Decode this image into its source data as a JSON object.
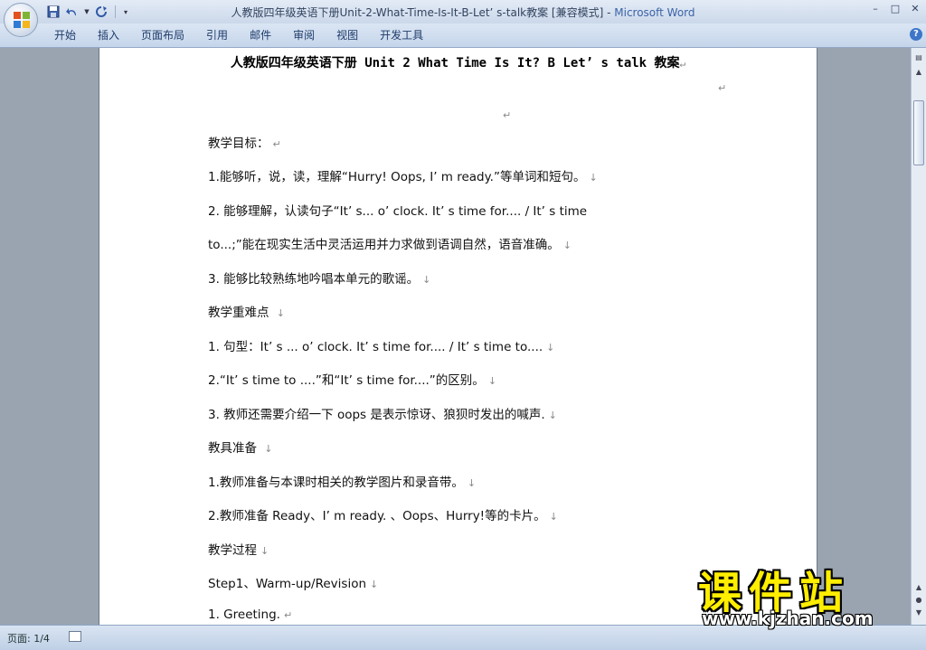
{
  "window": {
    "title": "人教版四年级英语下册Unit-2-What-Time-Is-It-B-Let’ s-talk教案 [兼容模式] - ",
    "app_name": "Microsoft Word",
    "controls": [
      "–",
      "□",
      "✕"
    ]
  },
  "ribbon": {
    "tabs": [
      "开始",
      "插入",
      "页面布局",
      "引用",
      "邮件",
      "审阅",
      "视图",
      "开发工具"
    ],
    "help": "?"
  },
  "document": {
    "title": "人教版四年级英语下册 Unit 2 What Time Is It? B Let’ s talk 教案",
    "para_mark": "↵",
    "line_mark": "↓",
    "lines": [
      {
        "text": "教学目标：",
        "mark": "↵"
      },
      {
        "text": "1.能够听，说，读，理解“Hurry! Oops, I’ m ready.”等单词和短句。",
        "mark": "↓"
      },
      {
        "text": "2. 能够理解，认读句子“It’ s... o’ clock. It’ s time for.... / It’ s time",
        "mark": ""
      },
      {
        "text": "to...;”能在现实生活中灵活运用并力求做到语调自然，语音准确。",
        "mark": "↓"
      },
      {
        "text": "3. 能够比较熟练地吟唱本单元的歌谣。",
        "mark": "↓"
      },
      {
        "text": "教学重难点  ",
        "mark": "↓"
      },
      {
        "text": "1. 句型：It’ s ... o’ clock. It’ s time for.... / It’ s time to....",
        "mark": "↓"
      },
      {
        "text": "2.“It’ s time to ....”和“It’ s time for....”的区别。",
        "mark": "↓"
      },
      {
        "text": "3. 教师还需要介绍一下 oops 是表示惊讶、狼狈时发出的喊声.",
        "mark": "↓"
      },
      {
        "text": "教具准备 ",
        "mark": "↓"
      },
      {
        "text": "1.教师准备与本课时相关的教学图片和录音带。",
        "mark": "↓"
      },
      {
        "text": "2.教师准备 Ready、I’ m ready. 、Oops、Hurry!等的卡片。",
        "mark": "↓"
      },
      {
        "text": "教学过程",
        "mark": "↓"
      },
      {
        "text": "Step1、Warm-up/Revision",
        "mark": "↓"
      },
      {
        "text": "1. Greeting.",
        "mark": "↵"
      }
    ]
  },
  "statusbar": {
    "page_label": "页面: 1/4"
  },
  "watermark": {
    "big_text": "课件站",
    "url": "www.kjzhan.com"
  },
  "colors": {
    "app_name": "#3b63a6",
    "watermark": "#ffee00",
    "workspace": "#9aa4b1"
  }
}
